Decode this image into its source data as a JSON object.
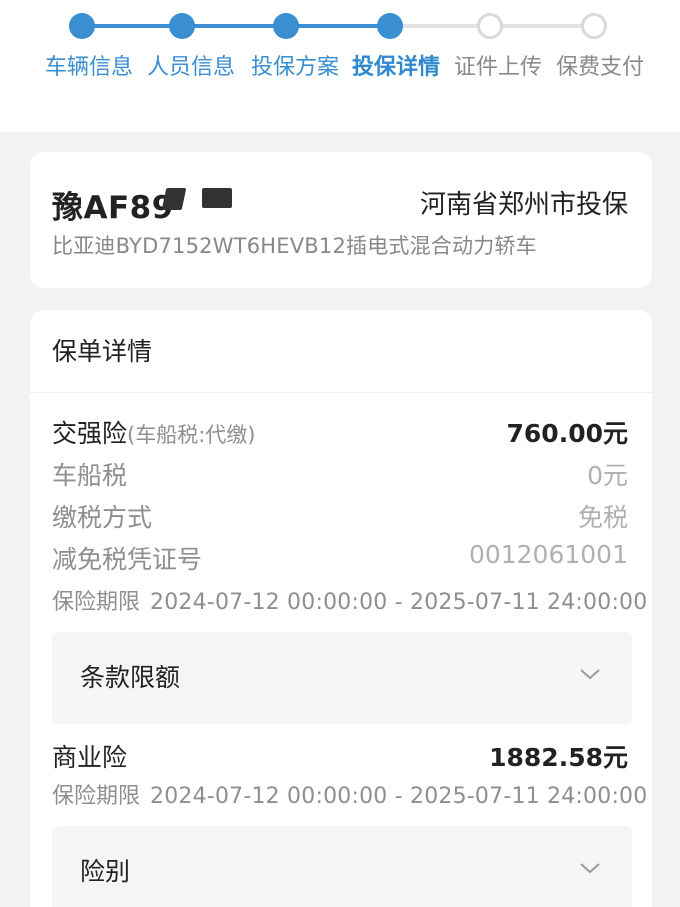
{
  "stepper": {
    "steps": [
      {
        "label": "车辆信息",
        "state": "done"
      },
      {
        "label": "人员信息",
        "state": "done"
      },
      {
        "label": "投保方案",
        "state": "done"
      },
      {
        "label": "投保详情",
        "state": "current"
      },
      {
        "label": "证件上传",
        "state": "todo"
      },
      {
        "label": "保费支付",
        "state": "todo"
      }
    ],
    "accent_color": "#3a8ed2"
  },
  "vehicle": {
    "plate": "豫AF89",
    "location": "河南省郑州市投保",
    "model": "比亚迪BYD7152WT6HEVB12插电式混合动力轿车"
  },
  "policy": {
    "title": "保单详情",
    "compulsory": {
      "name": "交强险",
      "note": "(车船税:代缴)",
      "amount": "760.00元",
      "vehicle_tax_label": "车船税",
      "vehicle_tax_value": "0元",
      "tax_method_label": "缴税方式",
      "tax_method_value": "免税",
      "exemption_cert_label": "减免税凭证号",
      "exemption_cert_value": "0012061001",
      "period_label": "保险期限",
      "period_value": "2024-07-12 00:00:00 - 2025-07-11 24:00:00",
      "terms_label": "条款限额"
    },
    "commercial": {
      "name": "商业险",
      "amount": "1882.58元",
      "period_label": "保险期限",
      "period_value": "2024-07-12 00:00:00 - 2025-07-11 24:00:00",
      "coverage_label": "险别"
    }
  }
}
